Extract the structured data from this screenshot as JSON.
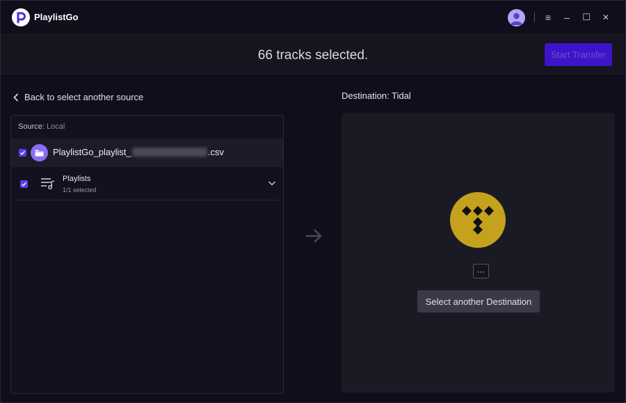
{
  "app": {
    "title": "PlaylistGo"
  },
  "window_controls": {
    "menu": "≡",
    "minimize": "–",
    "maximize": "☐",
    "close": "✕"
  },
  "header": {
    "tracks_selected": "66 tracks selected.",
    "start_transfer_label": "Start Transfer"
  },
  "source": {
    "back_label": "Back to select another source",
    "label_prefix": "Source:",
    "label_value": "Local",
    "file": {
      "name_start": "PlaylistGo_playlist_",
      "name_end": ".csv",
      "checked": true
    },
    "playlists": {
      "title": "Playlists",
      "subtitle": "1/1 selected",
      "checked": true
    }
  },
  "destination": {
    "label": "Destination: Tidal",
    "more_label": "···",
    "select_label": "Select another Destination"
  },
  "colors": {
    "accent": "#5b3fe6",
    "start_button": "#3d14c9",
    "tidal_logo": "#c4a21d",
    "background": "#0f0e1a"
  },
  "icons": [
    "playlistgo-logo-icon",
    "user-avatar-icon",
    "menu-icon",
    "minimize-icon",
    "maximize-icon",
    "close-icon",
    "chevron-left-icon",
    "folder-icon",
    "playlist-icon",
    "chevron-down-icon",
    "arrow-right-icon",
    "tidal-logo-icon"
  ]
}
